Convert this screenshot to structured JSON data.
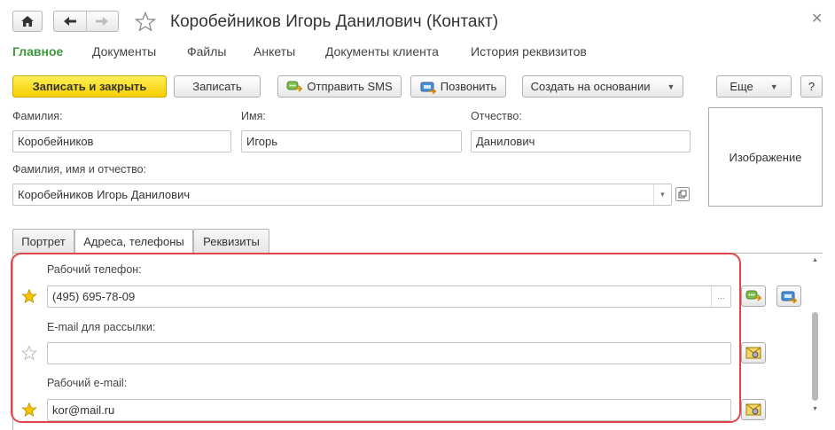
{
  "window": {
    "title": "Коробейников Игорь Данилович (Контакт)"
  },
  "sections": [
    {
      "label": "Главное",
      "active": true
    },
    {
      "label": "Документы"
    },
    {
      "label": "Файлы"
    },
    {
      "label": "Анкеты"
    },
    {
      "label": "Документы клиента"
    },
    {
      "label": "История реквизитов"
    }
  ],
  "toolbar": {
    "save_close": "Записать и закрыть",
    "save": "Записать",
    "send_sms": "Отправить SMS",
    "call": "Позвонить",
    "create_based": "Создать на основании",
    "more": "Еще",
    "help": "?"
  },
  "form": {
    "last_name_label": "Фамилия:",
    "last_name": "Коробейников",
    "first_name_label": "Имя:",
    "first_name": "Игорь",
    "patronymic_label": "Отчество:",
    "patronymic": "Данилович",
    "full_name_label": "Фамилия, имя и отчество:",
    "full_name": "Коробейников Игорь Данилович",
    "image_placeholder": "Изображение"
  },
  "tabs": [
    {
      "label": "Портрет"
    },
    {
      "label": "Адреса, телефоны",
      "active": true
    },
    {
      "label": "Реквизиты"
    }
  ],
  "contacts": {
    "work_phone_label": "Рабочий телефон:",
    "work_phone": "(495) 695-78-09",
    "work_phone_dots": "...",
    "email_mailing_label": "E-mail для рассылки:",
    "email_mailing": "",
    "work_email_label": "Рабочий e-mail:",
    "work_email": "kor@mail.ru"
  },
  "colors": {
    "accent_green": "#3a9a3a",
    "primary_yellow": "#f5cf00",
    "highlight_red": "#e0454a",
    "star_gold": "#f2c200"
  }
}
